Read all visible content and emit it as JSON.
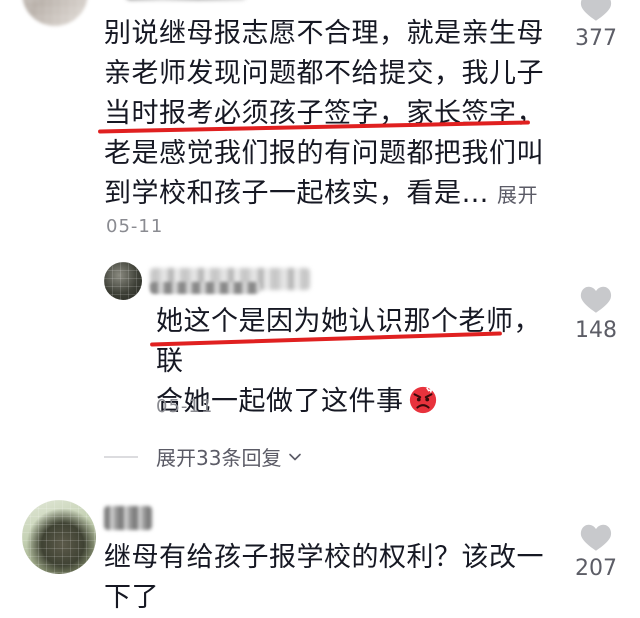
{
  "comments": [
    {
      "text_lines": [
        "别说继母报志愿不合理，就是亲生母",
        "亲老师发现问题都不给提交，我儿子",
        "当时报考必须孩子签字，家长签字，",
        "老是感觉我们报的有问题都把我们叫",
        "到学校和孩子一起核实，看是…"
      ],
      "expand_label": "展开",
      "date": "05-11",
      "likes": "377"
    },
    {
      "text_lines": [
        "她这个是因为她认识那个老师，联",
        "合她一起做了这件事"
      ],
      "emoji": "angry-face-icon",
      "date": "05-11",
      "likes": "148"
    },
    {
      "text_lines": [
        "继母有给孩子报学校的权利？该改一",
        "下了"
      ],
      "likes": "207"
    }
  ],
  "replies": {
    "expand_label": "展开33条回复"
  },
  "colors": {
    "text": "#161823",
    "secondary": "#8a8b91",
    "highlight_underline": "#e02020",
    "heart": "#c8c9cc"
  }
}
